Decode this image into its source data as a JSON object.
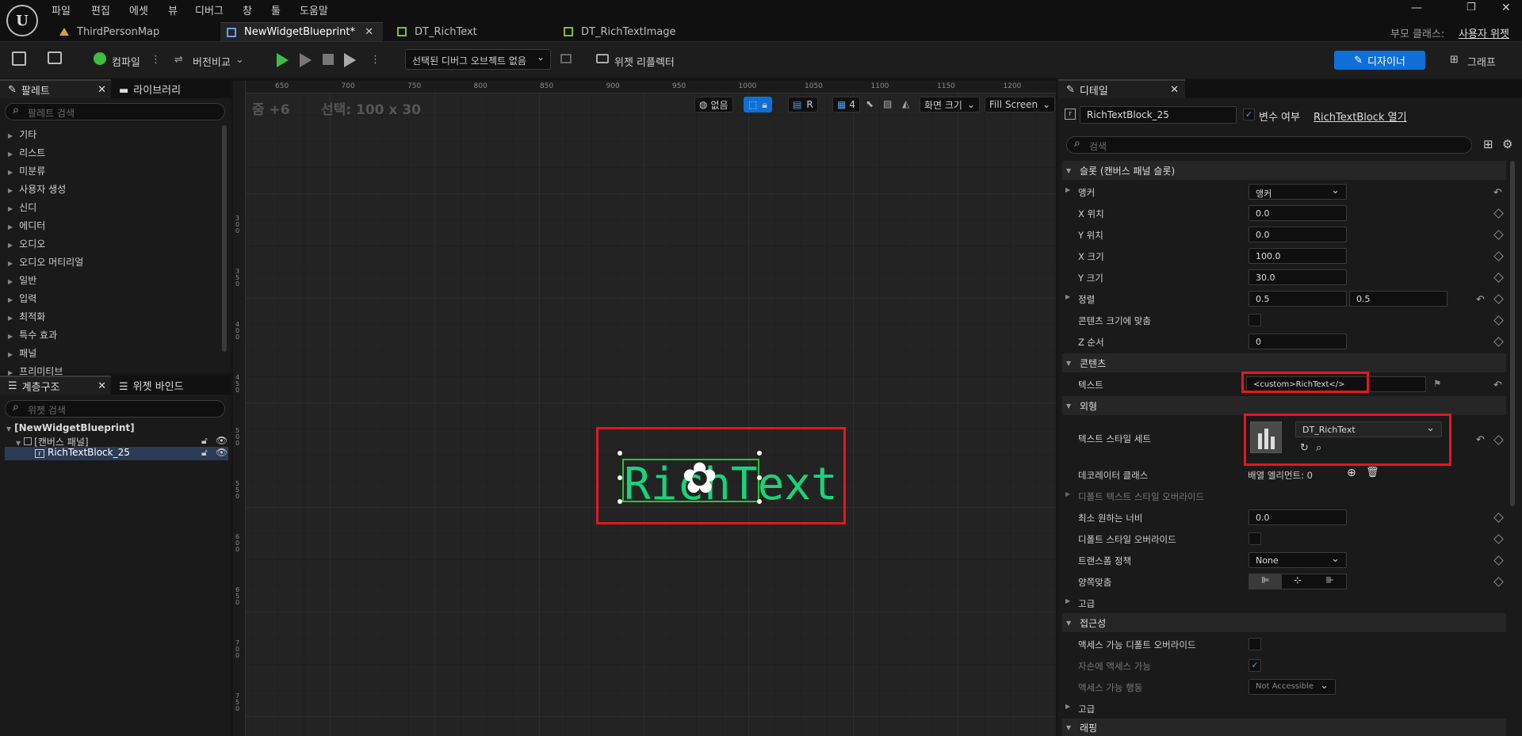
{
  "menu": {
    "items": [
      "파일",
      "편집",
      "에셋",
      "뷰",
      "디버그",
      "창",
      "툴",
      "도움말"
    ]
  },
  "tabs": [
    {
      "label": "ThirdPersonMap"
    },
    {
      "label": "NewWidgetBlueprint*"
    },
    {
      "label": "DT_RichText"
    },
    {
      "label": "DT_RichTextImage"
    }
  ],
  "parent_class": {
    "label": "부모 클래스:",
    "value": "사용자 위젯"
  },
  "toolbar": {
    "compile": "컴파일",
    "diff": "버전비교",
    "debug_select": "선택된 디버그 오브젝트 없음",
    "reflector": "위젯 리플렉터",
    "designer": "디자이너",
    "graph": "그래프"
  },
  "palette": {
    "tab": "팔레트",
    "library_tab": "라이브러리",
    "search_placeholder": "팔레트 검색",
    "categories": [
      "기타",
      "리스트",
      "미분류",
      "사용자 생성",
      "신디",
      "에디터",
      "오디오",
      "오디오 머티리얼",
      "일반",
      "입력",
      "최적화",
      "특수 효과",
      "패널",
      "프리미티브"
    ]
  },
  "hierarchy": {
    "tab": "계층구조",
    "binding_tab": "위젯 바인드",
    "search_placeholder": "위젯 검색",
    "root": "[NewWidgetBlueprint]",
    "canvas": "[캔버스 패널]",
    "item": "RichTextBlock_25"
  },
  "canvas": {
    "zoom": "줌 +6",
    "selection": "선택: 100 x 30",
    "none_label": "없음",
    "r_label": "R",
    "grid_count": "4",
    "screen_size": "화면 크기",
    "fill_screen": "Fill Screen",
    "preview_text": "RichText",
    "ruler_x": [
      "650",
      "700",
      "750",
      "800",
      "850",
      "900",
      "950",
      "1000",
      "1050",
      "1100",
      "1150",
      "1200"
    ],
    "ruler_y": [
      "300",
      "350",
      "400",
      "450",
      "500",
      "550",
      "600",
      "650",
      "700",
      "750"
    ]
  },
  "details": {
    "tab": "디테일",
    "name": "RichTextBlock_25",
    "is_variable": "변수 여부",
    "open_link": "RichTextBlock 열기",
    "search_placeholder": "검색",
    "slot_section": "슬롯 (캔버스 패널 슬롯)",
    "anchor_label": "앵커",
    "anchor_value": "앵커",
    "x_pos_label": "X 위치",
    "x_pos": "0.0",
    "y_pos_label": "Y 위치",
    "y_pos": "0.0",
    "x_size_label": "X 크기",
    "x_size": "100.0",
    "y_size_label": "Y 크기",
    "y_size": "30.0",
    "align_label": "정렬",
    "align_x": "0.5",
    "align_y": "0.5",
    "autosize_label": "콘텐츠 크기에 맞춤",
    "z_label": "Z 순서",
    "z_value": "0",
    "content_section": "콘텐츠",
    "text_label": "텍스트",
    "text_value": "<custom>RichText</>",
    "appearance_section": "외형",
    "style_set_label": "텍스트 스타일 세트",
    "style_set_value": "DT_RichText",
    "decorator_label": "데코레이터 클래스",
    "decorator_value": "배열 엘리먼트: 0",
    "default_override_label": "디폴트 텍스트 스타일 오버라이드",
    "min_width_label": "최소 원하는 너비",
    "min_width": "0.0",
    "apply_override_label": "디폴트 스타일 오버라이드",
    "transform_label": "트랜스폼 정책",
    "transform_value": "None",
    "justify_label": "양쪽맞춤",
    "advanced_label": "고급",
    "access_section": "접근성",
    "access_override_label": "액세스 가능 디폴트 오버라이드",
    "child_access_label": "자손에 액세스 가능",
    "access_behavior_label": "액세스 가능 행동",
    "access_behavior_value": "Not Accessible",
    "advanced2_label": "고급",
    "wrap_section": "래핑"
  },
  "colors": {
    "accent": "#0e70d6",
    "highlight": "#e2181f",
    "text_green": "#19d37a",
    "selection_green": "#2fc32f"
  }
}
